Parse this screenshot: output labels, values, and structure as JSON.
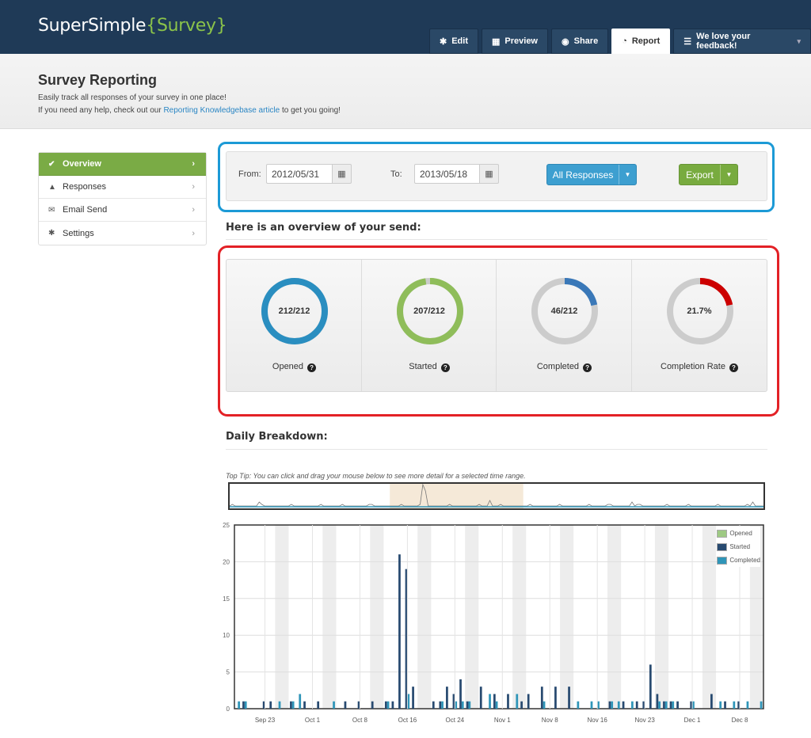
{
  "header": {
    "logo_main": "SuperSimple",
    "logo_accent": "{Survey}",
    "tabs": [
      {
        "label": "Edit",
        "icon": "gear-icon",
        "glyph": "✱"
      },
      {
        "label": "Preview",
        "icon": "film-icon",
        "glyph": "▦"
      },
      {
        "label": "Share",
        "icon": "globe-icon",
        "glyph": "◉"
      },
      {
        "label": "Report",
        "icon": "dashboard-icon",
        "glyph": "◔"
      },
      {
        "label": "We love your feedback!",
        "icon": "list-icon",
        "glyph": "☰",
        "dropdown": "▾"
      }
    ],
    "active_tab": "Report"
  },
  "subheader": {
    "title": "Survey Reporting",
    "line1": "Easily track all responses of your survey in one place!",
    "line2_prefix": "If you need any help, check out our",
    "line2_link": "Reporting Knowledgebase article",
    "line2_suffix": "to get you going!"
  },
  "sidebar": {
    "items": [
      {
        "label": "Overview",
        "icon": "check-icon",
        "glyph": "✔",
        "chev": "›"
      },
      {
        "label": "Responses",
        "icon": "user-icon",
        "glyph": "▲",
        "chev": "›"
      },
      {
        "label": "Email Send",
        "icon": "envelope-icon",
        "glyph": "✉",
        "chev": "›"
      },
      {
        "label": "Settings",
        "icon": "cog-icon",
        "glyph": "✱",
        "chev": "›"
      }
    ]
  },
  "filter": {
    "from_label": "From:",
    "from_value": "2012/05/31",
    "to_label": "To:",
    "to_value": "2013/05/18",
    "calendar_glyph": "▦",
    "responses_button": "All Responses",
    "export_button": "Export",
    "caret": "▼"
  },
  "overview": {
    "title": "Here is an overview of your send:",
    "stats": [
      {
        "value": "212/212",
        "label": "Opened",
        "fraction": 1.0,
        "color": "#2a8ec0"
      },
      {
        "value": "207/212",
        "label": "Started",
        "fraction": 0.976,
        "color": "#8fbd5a"
      },
      {
        "value": "46/212",
        "label": "Completed",
        "fraction": 0.217,
        "color": "#3a78b8"
      },
      {
        "value": "21.7%",
        "label": "Completion Rate",
        "fraction": 0.217,
        "color": "#cc0000"
      }
    ],
    "qmark": "?"
  },
  "breakdown": {
    "title": "Daily Breakdown:",
    "tip": "Top Tip: You can click and drag your mouse below to see more detail for a selected time range."
  },
  "chart_data": {
    "type": "bar",
    "ylim": [
      0,
      25
    ],
    "yticks": [
      "0",
      "5",
      "10",
      "15",
      "20",
      "25"
    ],
    "xticks": [
      "Sep 23",
      "Oct 1",
      "Oct 8",
      "Oct 16",
      "Oct 24",
      "Nov 1",
      "Nov 8",
      "Nov 16",
      "Nov 23",
      "Dec 1",
      "Dec 8"
    ],
    "series": [
      {
        "name": "Opened",
        "color": "#9ec983"
      },
      {
        "name": "Started",
        "color": "#284a70"
      },
      {
        "name": "Completed",
        "color": "#2f95b8"
      }
    ],
    "days": 78,
    "start_label_index": 4,
    "started": {
      "1": 1,
      "4": 1,
      "5": 1,
      "8": 1,
      "10": 1,
      "12": 1,
      "16": 1,
      "18": 1,
      "20": 1,
      "22": 1,
      "23": 1,
      "24": 21,
      "25": 19,
      "26": 3,
      "29": 1,
      "30": 1,
      "31": 3,
      "32": 2,
      "33": 4,
      "34": 1,
      "36": 3,
      "38": 2,
      "40": 2,
      "42": 1,
      "43": 2,
      "45": 3,
      "47": 3,
      "49": 3,
      "55": 1,
      "57": 1,
      "59": 1,
      "60": 1,
      "61": 6,
      "62": 2,
      "63": 1,
      "64": 1,
      "65": 1,
      "67": 1,
      "70": 2,
      "72": 1,
      "74": 1
    },
    "completed": {
      "0": 1,
      "1": 1,
      "6": 1,
      "8": 1,
      "9": 2,
      "14": 1,
      "22": 1,
      "25": 2,
      "30": 1,
      "32": 1,
      "33": 1,
      "34": 1,
      "37": 2,
      "38": 1,
      "41": 2,
      "45": 1,
      "50": 1,
      "52": 1,
      "53": 1,
      "55": 1,
      "56": 1,
      "58": 1,
      "62": 1,
      "63": 1,
      "64": 1,
      "67": 1,
      "71": 1,
      "73": 1,
      "75": 1,
      "77": 1
    },
    "overview_selection": [
      0.3,
      0.55
    ]
  }
}
